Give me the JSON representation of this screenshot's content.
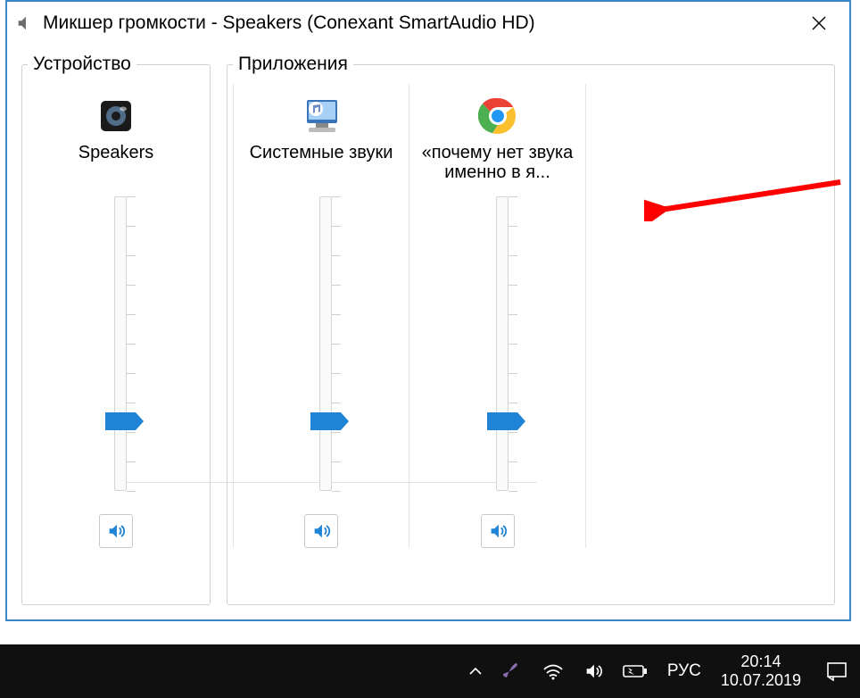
{
  "window": {
    "title": "Микшер громкости - Speakers (Conexant SmartAudio HD)"
  },
  "device_group_label": "Устройство",
  "apps_group_label": "Приложения",
  "channels": {
    "device": {
      "label": "Speakers",
      "level": 22
    },
    "system": {
      "label": "Системные звуки",
      "level": 22
    },
    "chrome": {
      "label": "«почему нет звука именно в я...",
      "level": 22
    }
  },
  "taskbar": {
    "lang": "РУС",
    "time": "20:14",
    "date": "10.07.2019"
  },
  "ticks": [
    0,
    10,
    20,
    30,
    40,
    50,
    60,
    70,
    80,
    90,
    100
  ]
}
